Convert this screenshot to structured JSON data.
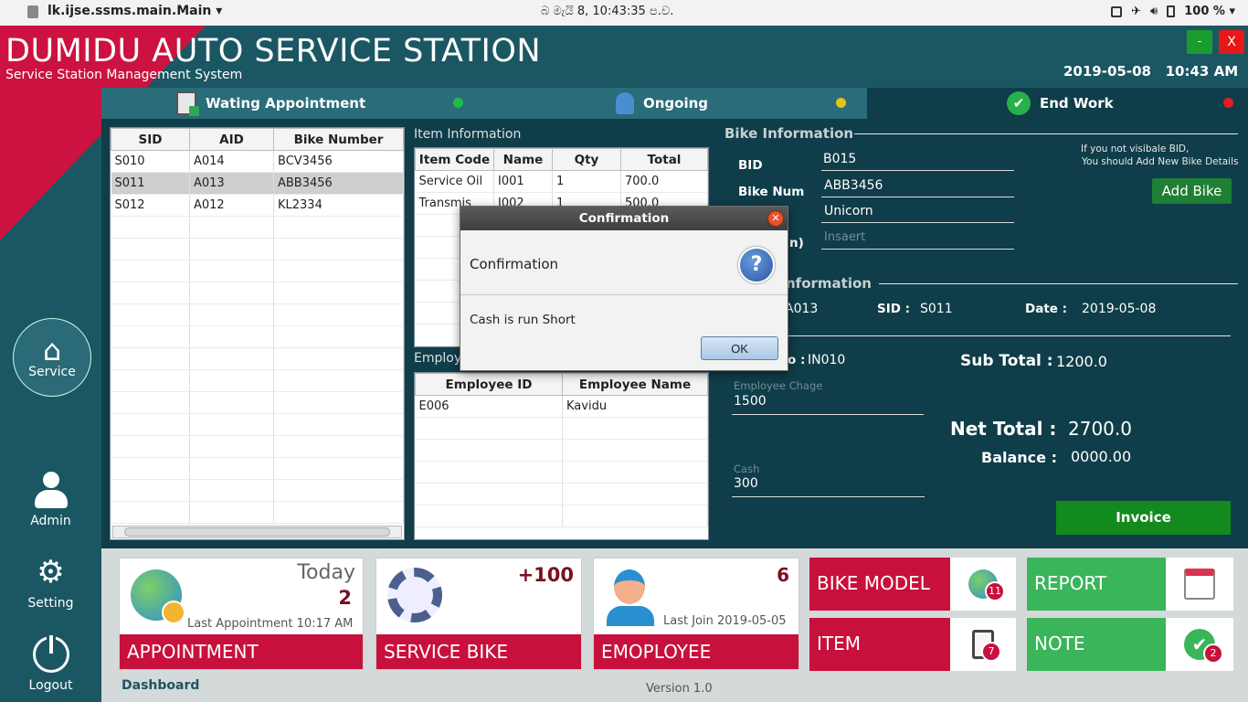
{
  "sysbar": {
    "app": "lk.ijse.ssms.main.Main ▾",
    "clock": "බ  මැයි     8, 10:43:35 ප.ව.",
    "battery": "100 % ▾"
  },
  "header": {
    "title": "DUMIDU AUTO SERVICE STATION",
    "subtitle": "Service Station Management System",
    "date": "2019-05-08",
    "time": "10:43 AM",
    "minimize": "-",
    "close": "X"
  },
  "tabs": [
    {
      "label": "Wating Appointment",
      "dot": "#22bb44"
    },
    {
      "label": "Ongoing",
      "dot": "#e3c417"
    },
    {
      "label": "End Work",
      "dot": "#e51b2a"
    }
  ],
  "nav": {
    "service": "Service",
    "admin": "Admin",
    "setting": "Setting",
    "logout": "Logout"
  },
  "service_table": {
    "headers": [
      "SID",
      "AID",
      "Bike Number"
    ],
    "rows": [
      [
        "S010",
        "A014",
        "BCV3456"
      ],
      [
        "S011",
        "A013",
        "ABB3456"
      ],
      [
        "S012",
        "A012",
        "KL2334"
      ]
    ],
    "selected": 1
  },
  "item_info": {
    "title": "Item Information",
    "headers": [
      "Item Code",
      "Name",
      "Qty",
      "Total"
    ],
    "rows": [
      [
        "Service Oil",
        "I001",
        "1",
        "700.0"
      ],
      [
        "Transmis",
        "I002",
        "1",
        "500.0"
      ]
    ]
  },
  "employee": {
    "title": "Employ",
    "headers": [
      "Employee ID",
      "Employee Name"
    ],
    "rows": [
      [
        "E006",
        "Kavidu"
      ]
    ]
  },
  "bike_info": {
    "title": "Bike Information",
    "note1": "If you not visibale BID,",
    "note2": "You should Add New Bike Details",
    "add_button": "Add Bike",
    "bid_label": "BID",
    "bid": "B015",
    "num_label": "Bike Num",
    "num": "ABB3456",
    "model": "Unicorn",
    "partial_label": "n)",
    "placeholder": "Insaert"
  },
  "appt_info": {
    "title": "nformation",
    "aid": "A013",
    "sid_label": "SID :",
    "sid": "S011",
    "date_label": "Date :",
    "date": "2019-05-08"
  },
  "invoice": {
    "no_label": "o :",
    "no": "IN010",
    "charge_label": "Employee Chage",
    "charge": "1500",
    "cash_label": "Cash",
    "cash": "300",
    "subtotal_label": "Sub Total :",
    "subtotal": "1200.0",
    "net_label": "Net Total :",
    "net": "2700.0",
    "balance_label": "Balance :",
    "balance": "0000.00",
    "button": "Invoice"
  },
  "cards": {
    "appointment": {
      "label": "APPOINTMENT",
      "today": "Today",
      "count": "2",
      "last": "Last Appointment",
      "time": "10:17 AM"
    },
    "service_bike": {
      "label": "SERVICE BIKE",
      "count": "+100"
    },
    "employee": {
      "label": "EMOPLOYEE",
      "count": "6",
      "last": "Last Join 2019-05-05"
    },
    "bike_model": {
      "label": "BIKE MODEL",
      "badge": "11"
    },
    "item": {
      "label": "ITEM",
      "badge": "7"
    },
    "report": {
      "label": "REPORT"
    },
    "note": {
      "label": "NOTE",
      "badge": "2"
    }
  },
  "footer": {
    "dashboard": "Dashboard",
    "version": "Version 1.0"
  },
  "dialog": {
    "title": "Confirmation",
    "heading": "Confirmation",
    "message": "Cash is run Short",
    "ok": "OK"
  }
}
